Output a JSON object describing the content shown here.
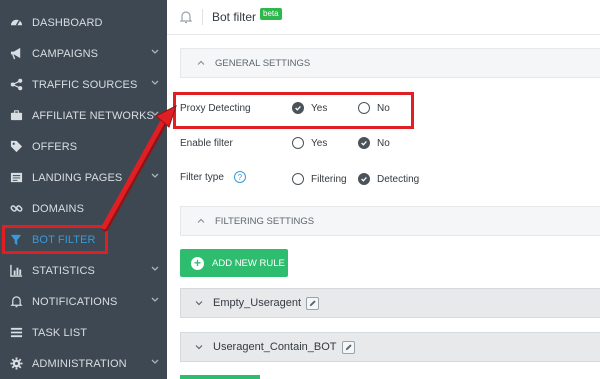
{
  "sidebar": {
    "items": [
      {
        "label": "DASHBOARD",
        "icon": "dashboard-icon",
        "chevron": false,
        "active": false
      },
      {
        "label": "CAMPAIGNS",
        "icon": "megaphone-icon",
        "chevron": true,
        "active": false
      },
      {
        "label": "TRAFFIC SOURCES",
        "icon": "share-icon",
        "chevron": true,
        "active": false
      },
      {
        "label": "AFFILIATE NETWORKS",
        "icon": "briefcase-icon",
        "chevron": true,
        "active": false
      },
      {
        "label": "OFFERS",
        "icon": "tag-icon",
        "chevron": false,
        "active": false
      },
      {
        "label": "LANDING PAGES",
        "icon": "newspaper-icon",
        "chevron": true,
        "active": false
      },
      {
        "label": "DOMAINS",
        "icon": "link-icon",
        "chevron": false,
        "active": false
      },
      {
        "label": "BOT FILTER",
        "icon": "filter-icon",
        "chevron": false,
        "active": true
      },
      {
        "label": "STATISTICS",
        "icon": "bar-chart-icon",
        "chevron": true,
        "active": false
      },
      {
        "label": "NOTIFICATIONS",
        "icon": "bell-icon",
        "chevron": true,
        "active": false
      },
      {
        "label": "TASK LIST",
        "icon": "list-icon",
        "chevron": false,
        "active": false
      },
      {
        "label": "ADMINISTRATION",
        "icon": "gear-icon",
        "chevron": true,
        "active": false
      }
    ]
  },
  "header": {
    "title": "Bot filter",
    "badge": "beta"
  },
  "general": {
    "title": "GENERAL SETTINGS",
    "proxy": {
      "label": "Proxy Detecting",
      "opt1": "Yes",
      "opt2": "No",
      "selected": "Yes"
    },
    "enable": {
      "label": "Enable filter",
      "opt1": "Yes",
      "opt2": "No",
      "selected": "No"
    },
    "type": {
      "label": "Filter type",
      "opt1": "Filtering",
      "opt2": "Detecting",
      "selected": "Detecting"
    }
  },
  "filtering": {
    "title": "FILTERING SETTINGS",
    "add_label": "ADD NEW RULE",
    "rules": [
      {
        "name": "Empty_Useragent"
      },
      {
        "name": "Useragent_Contain_BOT"
      }
    ]
  },
  "colors": {
    "sidebar_bg": "#3d4852",
    "accent": "#3a9ad9",
    "green": "#2ebd6f",
    "annotation_red": "#e01f25"
  }
}
